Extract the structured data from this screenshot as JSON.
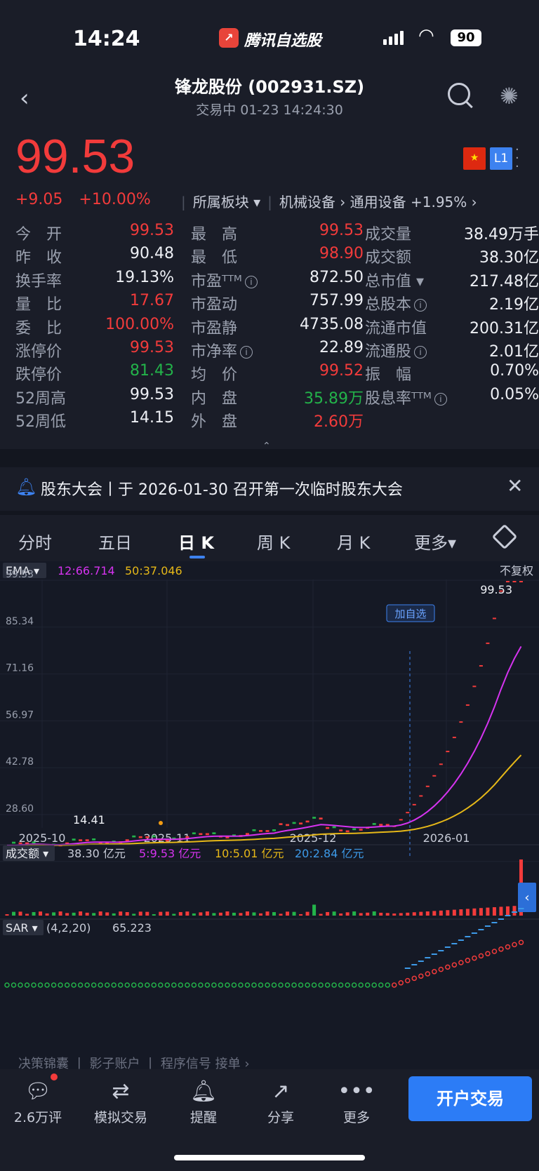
{
  "status_bar": {
    "time": "14:24",
    "app_name": "腾讯自选股",
    "battery": "90"
  },
  "header": {
    "title": "锋龙股份 (002931.SZ)",
    "subtitle": "交易中    01-23 14:24:30",
    "price": "99.53",
    "change": "+9.05",
    "change_pct": "+10.00%",
    "sector_label": "所属板块 ▾",
    "sector1": "机械设备 ›",
    "sector2": "通用设备 +1.95% ›",
    "level_badge": "L1"
  },
  "stats": [
    [
      {
        "l": "今　开",
        "v": "99.53",
        "c": "red"
      },
      {
        "l": "最　高",
        "v": "99.53",
        "c": "red"
      },
      {
        "l": "成交量",
        "v": "38.49万手",
        "c": "white"
      }
    ],
    [
      {
        "l": "昨　收",
        "v": "90.48",
        "c": "white"
      },
      {
        "l": "最　低",
        "v": "98.90",
        "c": "red"
      },
      {
        "l": "成交额",
        "v": "38.30亿",
        "c": "white"
      }
    ],
    [
      {
        "l": "换手率",
        "v": "19.13%",
        "c": "white"
      },
      {
        "l": "市盈ᵀᵀᴹ",
        "v": "872.50",
        "c": "white",
        "i": true
      },
      {
        "l": "总市值 ▾",
        "v": "217.48亿",
        "c": "white"
      }
    ],
    [
      {
        "l": "量　比",
        "v": "17.67",
        "c": "red"
      },
      {
        "l": "市盈动",
        "v": "757.99",
        "c": "white"
      },
      {
        "l": "总股本",
        "v": "2.19亿",
        "c": "white",
        "i": true
      }
    ],
    [
      {
        "l": "委　比",
        "v": "100.00%",
        "c": "red"
      },
      {
        "l": "市盈静",
        "v": "4735.08",
        "c": "white"
      },
      {
        "l": "流通市值",
        "v": "200.31亿",
        "c": "white"
      }
    ],
    [
      {
        "l": "涨停价",
        "v": "99.53",
        "c": "red"
      },
      {
        "l": "市净率",
        "v": "22.89",
        "c": "white",
        "i": true
      },
      {
        "l": "流通股",
        "v": "2.01亿",
        "c": "white",
        "i": true
      }
    ],
    [
      {
        "l": "跌停价",
        "v": "81.43",
        "c": "green"
      },
      {
        "l": "均　价",
        "v": "99.52",
        "c": "red"
      },
      {
        "l": "振　幅",
        "v": "0.70%",
        "c": "white"
      }
    ],
    [
      {
        "l": "52周高",
        "v": "99.53",
        "c": "white"
      },
      {
        "l": "内　盘",
        "v": "35.89万",
        "c": "green"
      },
      {
        "l": "股息率ᵀᵀᴹ",
        "v": "0.05%",
        "c": "white",
        "i": true
      }
    ],
    [
      {
        "l": "52周低",
        "v": "14.15",
        "c": "white"
      },
      {
        "l": "外　盘",
        "v": "2.60万",
        "c": "red"
      }
    ]
  ],
  "notice": "股东大会丨于 2026-01-30 召开第一次临时股东大会",
  "tabs": [
    "分时",
    "五日",
    "日 K",
    "周 K",
    "月 K",
    "更多▾"
  ],
  "active_tab": "日 K",
  "chart_labels": {
    "ema_label": "EMA ▾",
    "ema12": "12:66.714",
    "ema50": "50:37.046",
    "adjust": "不复权",
    "watch_tag": "加自选",
    "vol_label": "成交额 ▾",
    "vol_total": "38.30 亿元",
    "vol5": "5:9.53 亿元",
    "vol10": "10:5.01 亿元",
    "vol20": "20:2.84 亿元",
    "sar_label": "SAR ▾",
    "sar_params": "(4,2,20)",
    "sar_val": "65.223",
    "footer_partial": "决策锦囊  丨  影子账户  丨  程序信号  接单 ›"
  },
  "chart_data": {
    "type": "candlestick",
    "yticks": [
      "99.53",
      "85.34",
      "71.16",
      "56.97",
      "42.78",
      "28.60",
      "14.41"
    ],
    "ylim": [
      14.41,
      99.53
    ],
    "xticks": [
      "2025-10",
      "2025-11",
      "2025-12",
      "2026-01"
    ],
    "high_label": "99.53",
    "low_label": "14.41",
    "colors": {
      "up": "#f23b3b",
      "down": "#23b34a",
      "ema12": "#d633f0",
      "ema50": "#e6b818",
      "accent": "#3d82f0"
    }
  },
  "bottom_bar": {
    "comments": "2.6万评",
    "simulate": "模拟交易",
    "remind": "提醒",
    "share": "分享",
    "more": "更多",
    "open": "开户交易"
  }
}
